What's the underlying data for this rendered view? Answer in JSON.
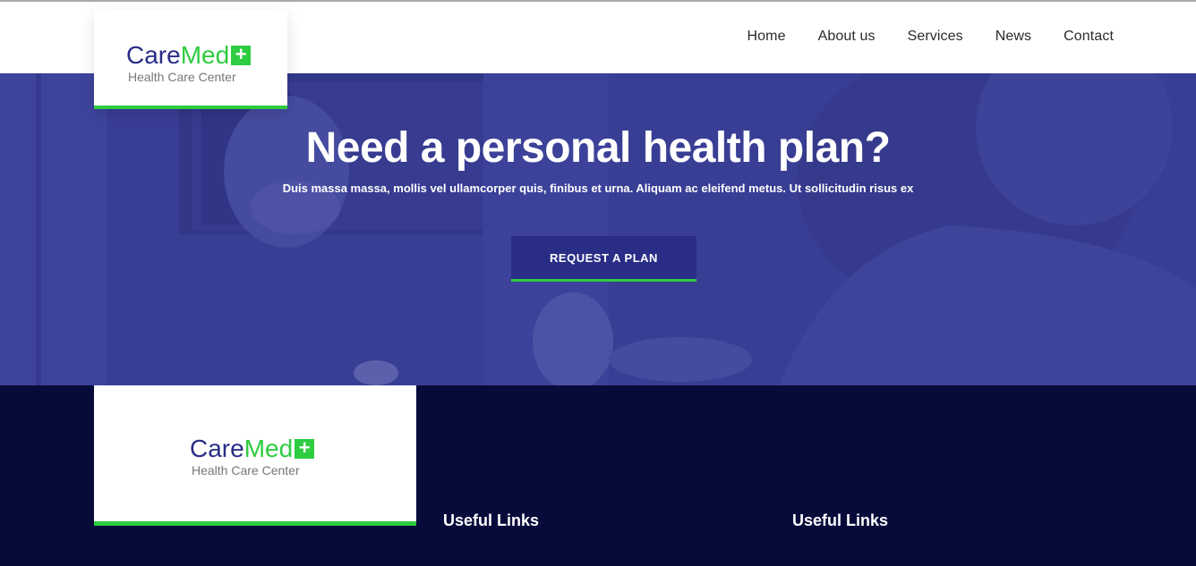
{
  "brand": {
    "name_part1": "Care",
    "name_part2": "Med",
    "plus_symbol": "+",
    "tagline": "Health Care Center",
    "colors": {
      "primary": "#2a2d86",
      "accent": "#2ecc40",
      "footer_bg": "#070b3a"
    }
  },
  "nav": {
    "items": [
      {
        "label": "Home"
      },
      {
        "label": "About us"
      },
      {
        "label": "Services"
      },
      {
        "label": "News"
      },
      {
        "label": "Contact"
      }
    ]
  },
  "hero": {
    "title": "Need a personal health plan?",
    "subtitle": "Duis massa massa, mollis vel ullamcorper quis, finibus et urna. Aliquam ac eleifend metus. Ut sollicitudin risus ex",
    "cta_label": "REQUEST A PLAN"
  },
  "footer": {
    "column1_title": "Useful Links",
    "column2_title": "Useful Links"
  }
}
